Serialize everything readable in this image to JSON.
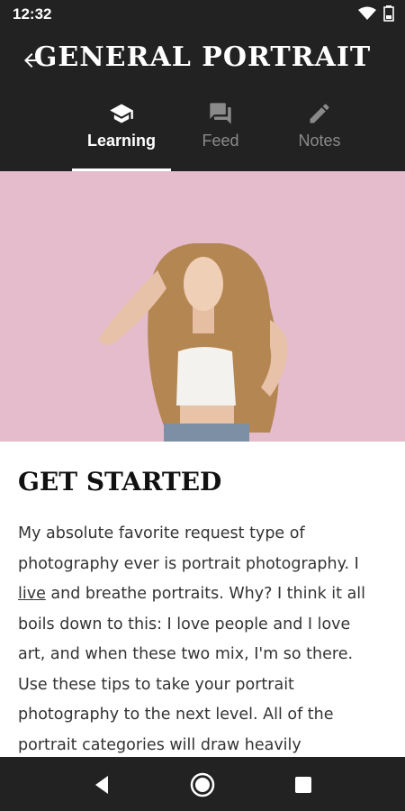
{
  "status_bar": {
    "time": "12:32",
    "wifi_icon": "wifi-icon",
    "battery_icon": "battery-icon"
  },
  "app_bar": {
    "title": "GENERAL PORTRAIT",
    "back_icon": "arrow-left-icon"
  },
  "tabs": [
    {
      "label": "Learning",
      "icon": "graduation-cap-icon",
      "active": true
    },
    {
      "label": "Feed",
      "icon": "chat-icon",
      "active": false
    },
    {
      "label": "Notes",
      "icon": "pencil-icon",
      "active": false
    }
  ],
  "article": {
    "heading": "GET STARTED",
    "paragraph_part1": "My absolute favorite request type of photography ever is portrait photography. I ",
    "link_text": "live",
    "paragraph_part2": " and breathe portraits. Why? I think it all boils down to this: I love people and I love art, and when these two mix, I'm so there. Use these tips to take your portrait photography to the next level. All of the portrait categories will draw heavily"
  },
  "colors": {
    "bars": "#222222",
    "hero_bg": "#e5bfcc",
    "text": "#333333"
  },
  "nav": {
    "back": "nav-back-icon",
    "home": "nav-home-icon",
    "recents": "nav-recents-icon"
  }
}
